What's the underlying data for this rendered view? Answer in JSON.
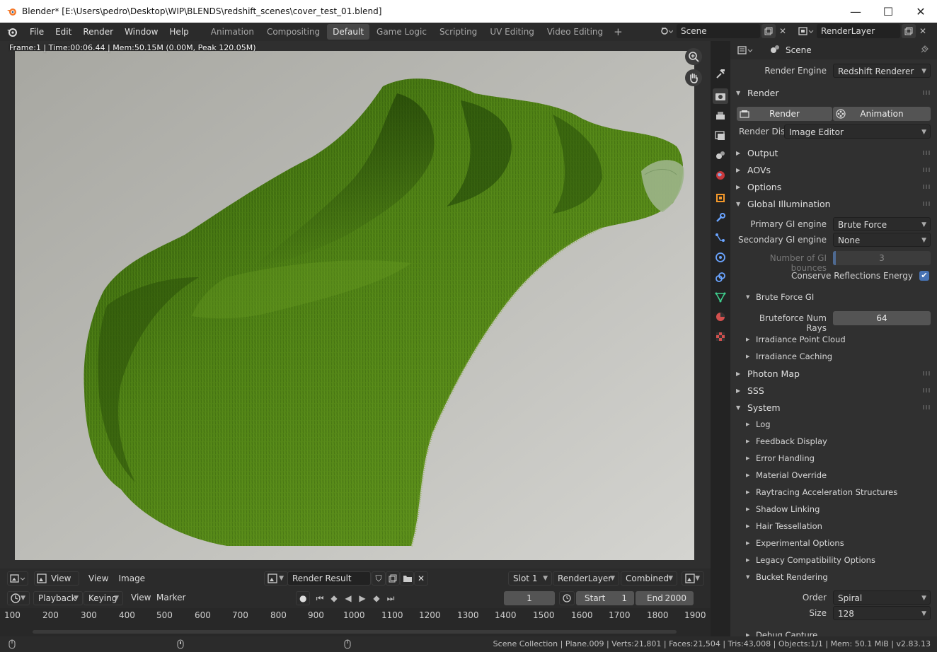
{
  "window": {
    "title": "Blender* [E:\\Users\\pedro\\Desktop\\WIP\\BLENDS\\redshift_scenes\\cover_test_01.blend]",
    "minimize": "—",
    "maximize": "☐",
    "close": "✕"
  },
  "menu": [
    "File",
    "Edit",
    "Render",
    "Window",
    "Help"
  ],
  "workspaces": [
    "Animation",
    "Compositing",
    "Default",
    "Game Logic",
    "Scripting",
    "UV Editing",
    "Video Editing"
  ],
  "active_workspace": "Default",
  "scene": {
    "name": "Scene"
  },
  "view_layer": {
    "name": "RenderLayer"
  },
  "viewport": {
    "info": "Frame:1 | Time:00:06.44 | Mem:50.15M (0.00M, Peak 120.05M)"
  },
  "image_editor": {
    "view_menu": "View",
    "menus": [
      "View",
      "Image"
    ],
    "image_name": "Render Result",
    "slot": "Slot 1",
    "layer": "RenderLayer",
    "pass": "Combined"
  },
  "timeline": {
    "playback": "Playback",
    "keying": "Keying",
    "menus": [
      "View",
      "Marker"
    ],
    "current_frame": "1",
    "start_label": "Start",
    "start": "1",
    "end_label": "End",
    "end": "2000",
    "ticks": [
      "100",
      "200",
      "300",
      "400",
      "500",
      "600",
      "700",
      "800",
      "900",
      "1000",
      "1100",
      "1200",
      "1300",
      "1400",
      "1500",
      "1600",
      "1700",
      "1800",
      "1900"
    ]
  },
  "status": {
    "text": "Scene Collection | Plane.009 | Verts:21,801 | Faces:21,504 | Tris:43,008 | Objects:1/1 | Mem: 50.1 MiB | v2.83.13"
  },
  "properties": {
    "context": "Scene",
    "render_engine_label": "Render Engine",
    "render_engine": "Redshift Renderer",
    "panels": {
      "render": "Render",
      "output": "Output",
      "aovs": "AOVs",
      "options": "Options",
      "gi": "Global Illumination",
      "photon": "Photon Map",
      "sss": "SSS",
      "system": "System"
    },
    "render_button": "Render",
    "animation_button": "Animation",
    "render_display_label": "Render Dis...",
    "render_display": "Image Editor",
    "gi": {
      "primary_label": "Primary GI engine",
      "primary": "Brute Force",
      "secondary_label": "Secondary GI engine",
      "secondary": "None",
      "bounces_label": "Number of GI bounces",
      "bounces": "3",
      "conserve_label": "Conserve Reflections Energy",
      "conserve": true,
      "brute_force": "Brute Force GI",
      "num_rays_label": "Bruteforce Num Rays",
      "num_rays": "64",
      "irradiance_point_cloud": "Irradiance Point Cloud",
      "irradiance_caching": "Irradiance Caching"
    },
    "system": {
      "items": [
        "Log",
        "Feedback Display",
        "Error Handling",
        "Material Override",
        "Raytracing Acceleration Structures",
        "Shadow Linking",
        "Hair Tessellation",
        "Experimental Options",
        "Legacy Compatibility Options"
      ],
      "bucket": "Bucket Rendering",
      "order_label": "Order",
      "order": "Spiral",
      "size_label": "Size",
      "size": "128",
      "debug": "Debug Capture"
    }
  },
  "colors": {
    "accent": "#4772b3",
    "grass": "#4a7a12",
    "background": "#303030"
  }
}
